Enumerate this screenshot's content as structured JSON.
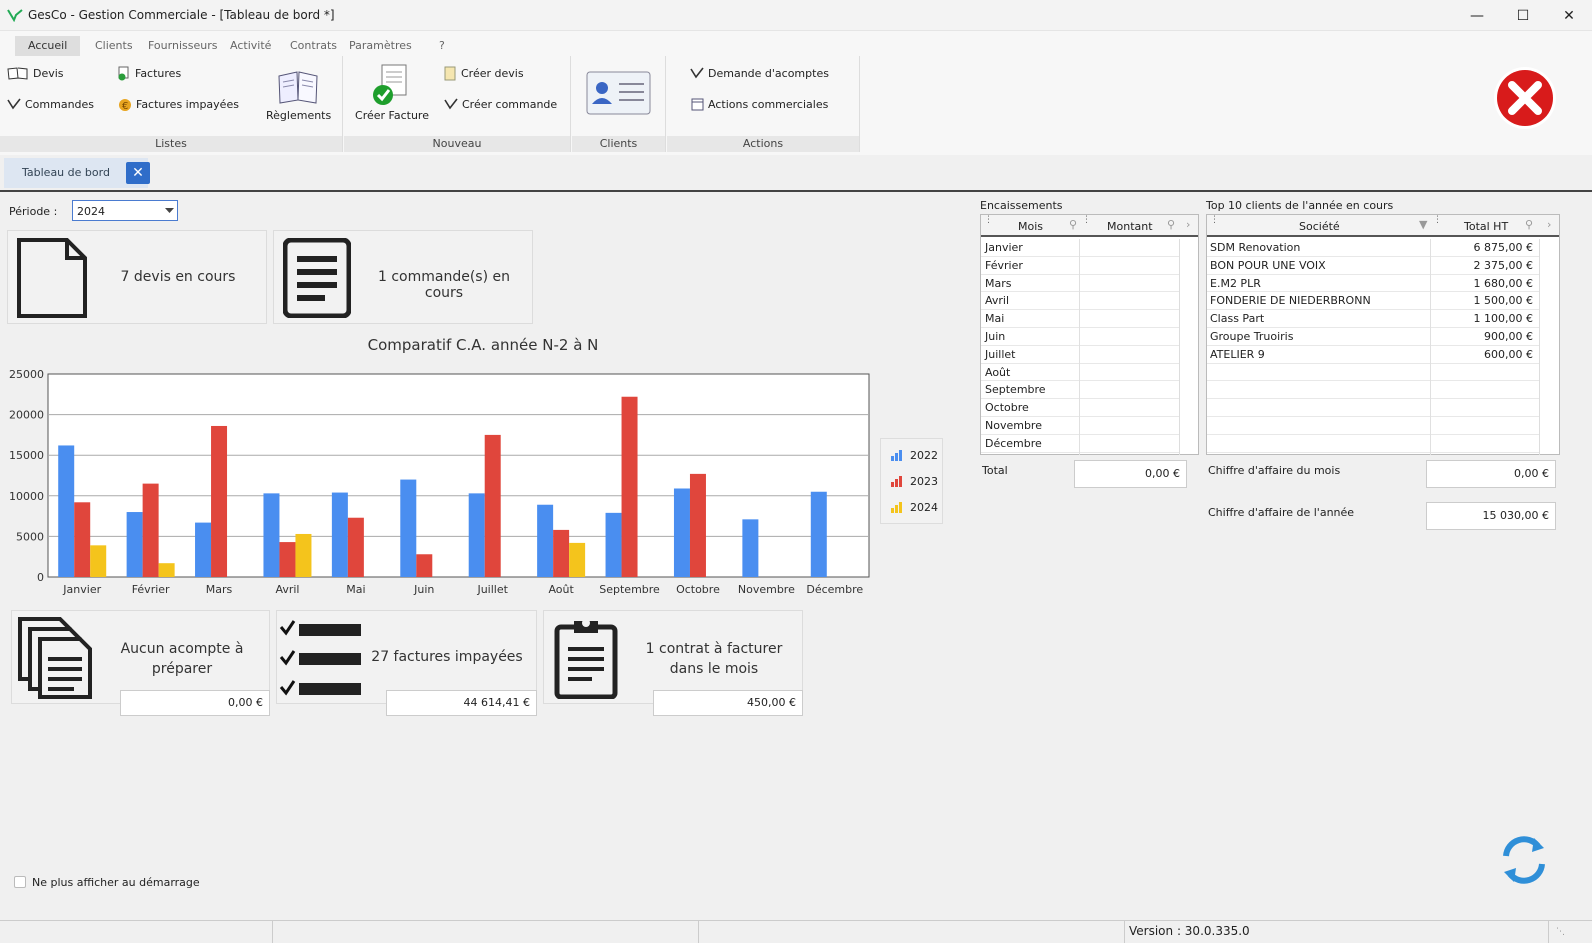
{
  "window": {
    "title": "GesCo - Gestion Commerciale - [Tableau de bord *]"
  },
  "menu": {
    "tabs": [
      "Accueil",
      "Clients",
      "Fournisseurs",
      "Activité",
      "Contrats",
      "Paramètres",
      "?"
    ],
    "active": "Accueil"
  },
  "ribbon": {
    "devis": "Devis",
    "commandes": "Commandes",
    "factures": "Factures",
    "factures_impayees": "Factures impayées",
    "reglements": "Règlements",
    "creer_facture": "Créer Facture",
    "creer_devis": "Créer devis",
    "creer_commande": "Créer commande",
    "demande_acomptes": "Demande d'acomptes",
    "actions_commerciales": "Actions commerciales",
    "groups": {
      "listes": "Listes",
      "nouveau": "Nouveau",
      "clients": "Clients",
      "actions": "Actions"
    }
  },
  "doc_tab": {
    "label": "Tableau de bord"
  },
  "period": {
    "label": "Période :",
    "value": "2024"
  },
  "cards": {
    "devis": "7 devis en cours",
    "commandes": "1 commande(s) en cours",
    "acompte_text": "Aucun acompte à préparer",
    "acompte_amount": "0,00 €",
    "factures_text": "27 factures impayées",
    "factures_amount": "44 614,41 €",
    "contrat_text": "1 contrat à facturer dans le mois",
    "contrat_amount": "450,00 €"
  },
  "chart_data": {
    "type": "bar",
    "title": "Comparatif C.A. année N-2 à N",
    "categories": [
      "Janvier",
      "Février",
      "Mars",
      "Avril",
      "Mai",
      "Juin",
      "Juillet",
      "Août",
      "Septembre",
      "Octobre",
      "Novembre",
      "Décembre"
    ],
    "series": [
      {
        "name": "2022",
        "color": "#4a8ef0",
        "values": [
          16200,
          8000,
          6700,
          10300,
          10400,
          12000,
          10300,
          8900,
          7900,
          10900,
          7100,
          10500
        ]
      },
      {
        "name": "2023",
        "color": "#e0463c",
        "values": [
          9200,
          11500,
          18600,
          4300,
          7300,
          2800,
          17500,
          5800,
          22200,
          12700,
          null,
          null
        ]
      },
      {
        "name": "2024",
        "color": "#f4c41c",
        "values": [
          3900,
          1700,
          null,
          5300,
          null,
          null,
          null,
          4200,
          null,
          null,
          null,
          null
        ]
      }
    ],
    "ylim": [
      0,
      25000
    ],
    "yticks": [
      "0",
      "5000",
      "10000",
      "15000",
      "20000",
      "25000"
    ],
    "grid": true,
    "legend": "right"
  },
  "encaissements": {
    "title": "Encaissements",
    "col_mois": "Mois",
    "col_montant": "Montant",
    "months": [
      "Janvier",
      "Février",
      "Mars",
      "Avril",
      "Mai",
      "Juin",
      "Juillet",
      "Août",
      "Septembre",
      "Octobre",
      "Novembre",
      "Décembre"
    ],
    "total_label": "Total",
    "total_value": "0,00 €"
  },
  "top10": {
    "title": "Top 10 clients de l'année en cours",
    "col_societe": "Société",
    "col_total": "Total HT",
    "rows": [
      {
        "societe": "SDM Renovation",
        "total": "6 875,00 €"
      },
      {
        "societe": "BON POUR UNE VOIX",
        "total": "2 375,00 €"
      },
      {
        "societe": "E.M2 PLR",
        "total": "1 680,00 €"
      },
      {
        "societe": "FONDERIE DE NIEDERBRONN",
        "total": "1 500,00 €"
      },
      {
        "societe": "Class Part",
        "total": "1 100,00 €"
      },
      {
        "societe": "Groupe Truoiris",
        "total": "900,00 €"
      },
      {
        "societe": "ATELIER 9",
        "total": "600,00 €"
      }
    ],
    "ca_mois_label": "Chiffre d'affaire du mois",
    "ca_mois_value": "0,00 €",
    "ca_annee_label": "Chiffre d'affaire de l'année",
    "ca_annee_value": "15 030,00 €"
  },
  "footer": {
    "checkbox_label": "Ne plus afficher au démarrage",
    "version": "Version : 30.0.335.0"
  }
}
